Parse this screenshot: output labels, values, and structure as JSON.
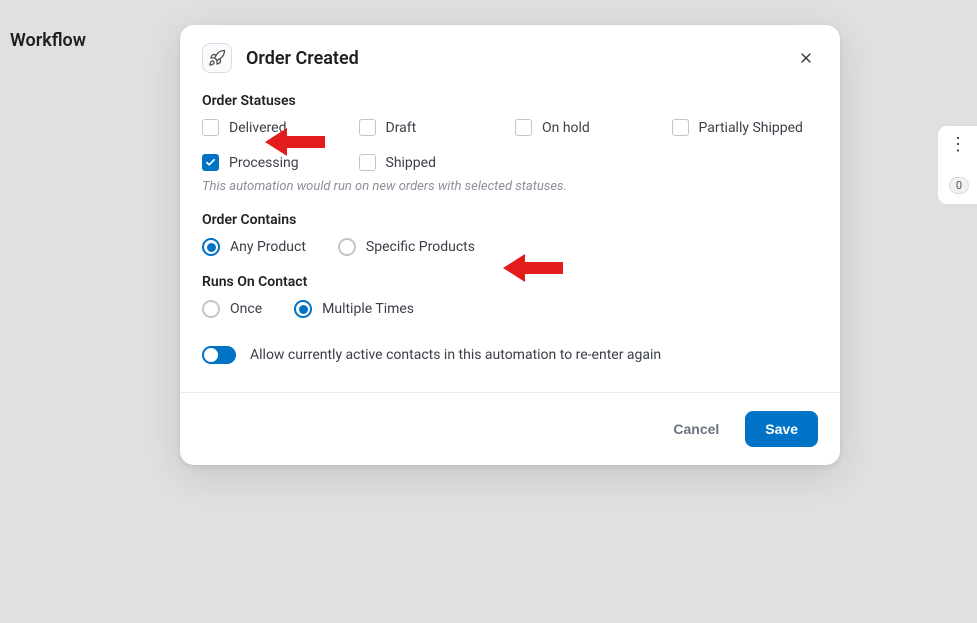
{
  "background": {
    "page_title": "Workflow",
    "side_badge": "0"
  },
  "modal": {
    "title": "Order Created",
    "sections": {
      "order_statuses": {
        "label": "Order Statuses",
        "hint": "This automation would run on new orders with selected statuses.",
        "options": {
          "delivered": {
            "label": "Delivered",
            "checked": false
          },
          "draft": {
            "label": "Draft",
            "checked": false
          },
          "on_hold": {
            "label": "On hold",
            "checked": false
          },
          "partially_shipped": {
            "label": "Partially Shipped",
            "checked": false
          },
          "processing": {
            "label": "Processing",
            "checked": true
          },
          "shipped": {
            "label": "Shipped",
            "checked": false
          }
        }
      },
      "order_contains": {
        "label": "Order Contains",
        "options": {
          "any_product": {
            "label": "Any Product",
            "selected": true
          },
          "specific_products": {
            "label": "Specific Products",
            "selected": false
          }
        }
      },
      "runs_on_contact": {
        "label": "Runs On Contact",
        "options": {
          "once": {
            "label": "Once",
            "selected": false
          },
          "multiple": {
            "label": "Multiple Times",
            "selected": true
          }
        }
      },
      "reenter": {
        "label": "Allow currently active contacts in this automation to re-enter again",
        "enabled": true
      }
    },
    "footer": {
      "cancel": "Cancel",
      "save": "Save"
    }
  }
}
